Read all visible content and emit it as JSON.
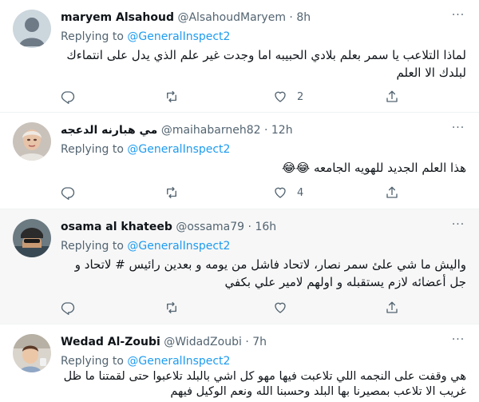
{
  "tweets": [
    {
      "name": "maryem Alsahoud",
      "handle": "@AlsahoudMaryem",
      "dot": "·",
      "time": "8h",
      "replying_label": "Replying to",
      "replying_mention": "@GeneralInspect2",
      "text": "لماذا التلاعب يا سمر بعلم بلادي الحبيبه اما وجدت غير علم الذي يدل على انتماءك لبلدك الا العلم",
      "reply_count": "",
      "retweet_count": "",
      "like_count": "2"
    },
    {
      "name": "مي هبارنه الدعجه",
      "handle": "@maihabarneh82",
      "dot": "·",
      "time": "12h",
      "replying_label": "Replying to",
      "replying_mention": "@GeneralInspect2",
      "text": "هذا العلم الجديد للهويه الجامعه 😂😂",
      "reply_count": "",
      "retweet_count": "",
      "like_count": "4"
    },
    {
      "name": "osama al khateeb",
      "handle": "@ossama79",
      "dot": "·",
      "time": "16h",
      "replying_label": "Replying to",
      "replying_mention": "@GeneralInspect2",
      "text": "واليش ما شي علئ سمر نصار، لاتحاد فاشل من يومه و بعدين رائيس # لاتحاد و جل أعضائه لازم يستقبله و اولهم لامير علي بكفي",
      "reply_count": "",
      "retweet_count": "",
      "like_count": ""
    },
    {
      "name": "Wedad Al-Zoubi",
      "handle": "@WidadZoubi",
      "dot": "·",
      "time": "7h",
      "replying_label": "Replying to",
      "replying_mention": "@GeneralInspect2",
      "text": "هي وقفت على النجمه اللي تلاعبت فيها مهو كل اشي بالبلد تلاعبوا حتى لقمتنا ما ظل غريب الا تلاعب بمصيرنا بها البلد وحسبنا الله ونعم الوكيل فيهم",
      "reply_count": "",
      "retweet_count": "",
      "like_count": ""
    }
  ],
  "more_glyph": "···",
  "colors": {
    "text": "#0f1419",
    "secondary": "#536471",
    "link": "#1d9bf0",
    "border": "#eff3f4",
    "hover_bg": "#f7f7f7"
  }
}
